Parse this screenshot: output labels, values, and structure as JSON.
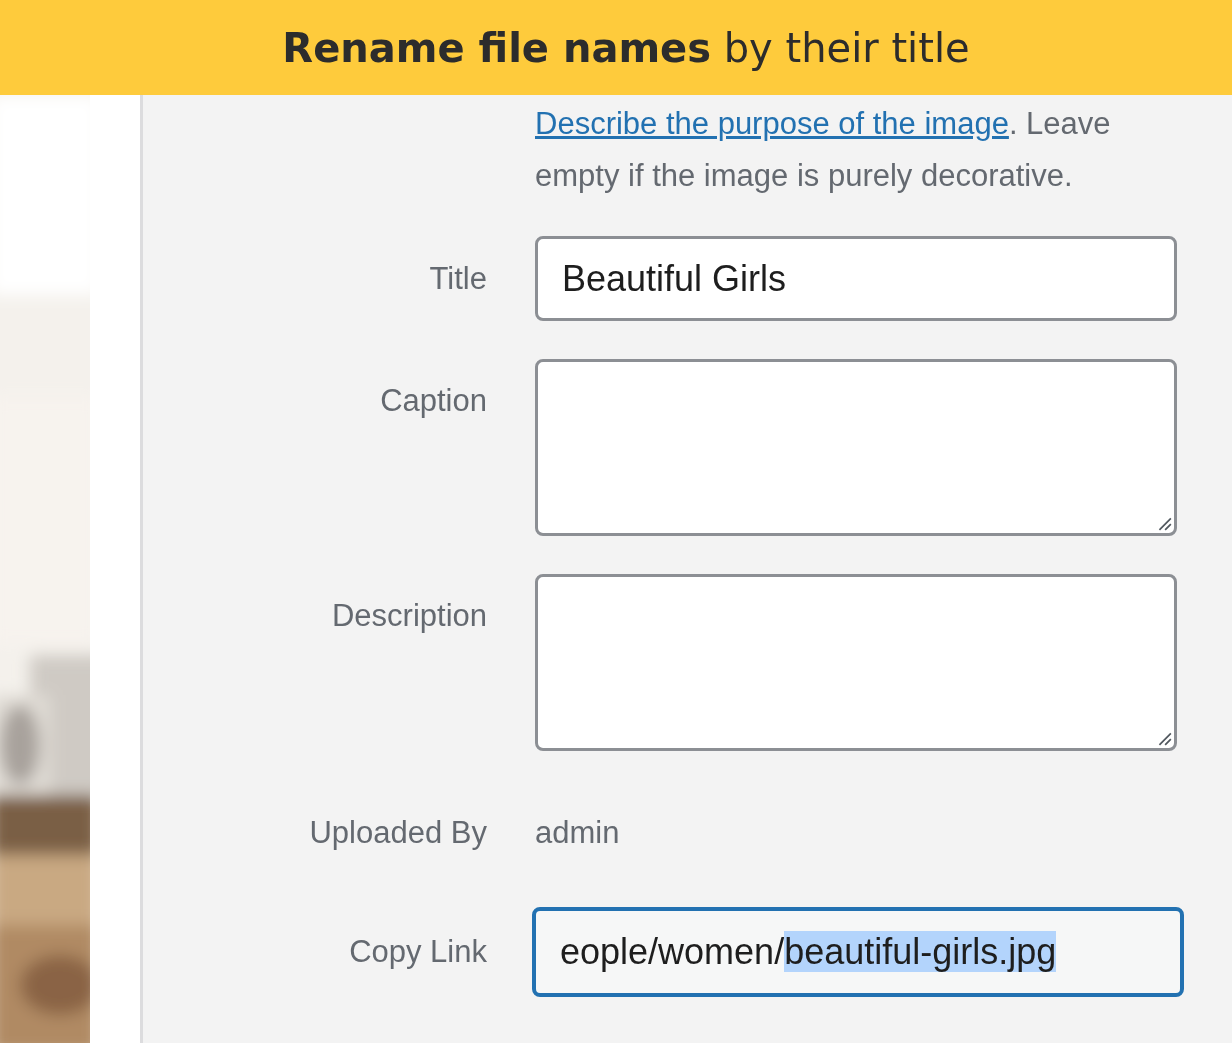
{
  "banner": {
    "title": "**Rename file names** by their title"
  },
  "fields": [
    {
      "kind": "help",
      "link": "Describe the purpose of the image",
      "text": ". Leave empty if the image is purely decorative."
    },
    {
      "kind": "input",
      "label": "Title",
      "value": "Beautiful Girls"
    },
    {
      "kind": "textarea",
      "label": "Caption"
    },
    {
      "kind": "textarea",
      "label": "Description"
    },
    {
      "kind": "text",
      "label": "Uploaded By",
      "value": "admin"
    },
    {
      "kind": "copy",
      "label": "Copy Link",
      "focused": true,
      "parts": [
        {
          "text": "eople/women/",
          "selected": false
        },
        {
          "text": "beautiful-girls.jpg",
          "selected": true
        }
      ]
    }
  ]
}
